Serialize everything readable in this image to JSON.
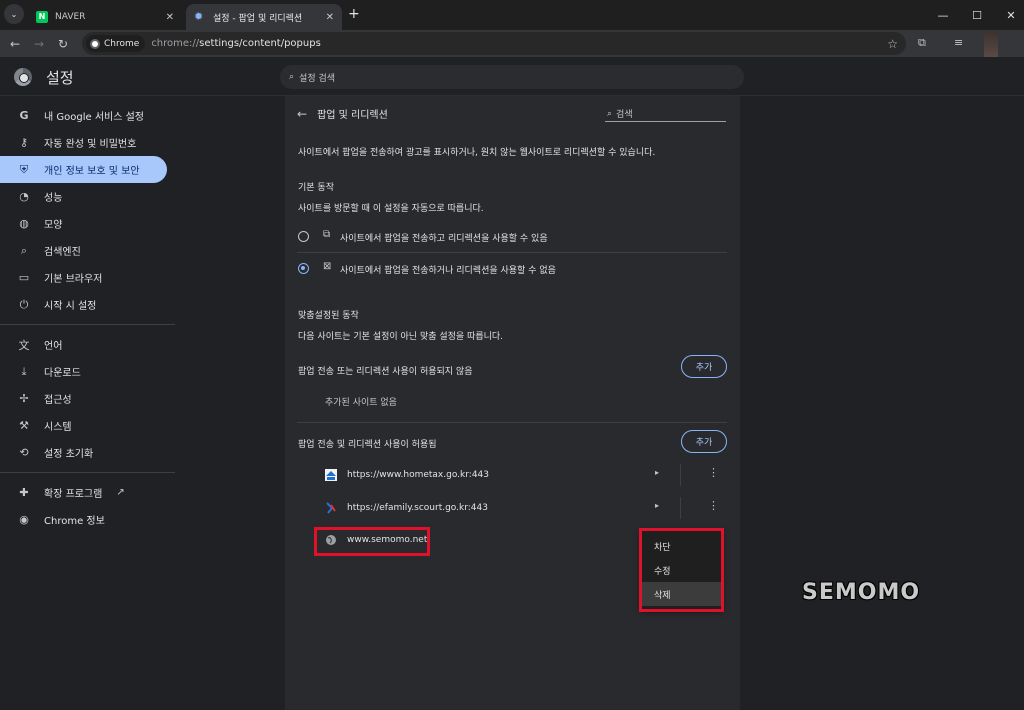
{
  "tabs": [
    {
      "label": "NAVER",
      "favicon": "naver-favicon"
    },
    {
      "label": "설정 - 팝업 및 리디렉션",
      "favicon": "gear-icon"
    }
  ],
  "toolbar": {
    "chip_label": "Chrome",
    "url_scheme": "chrome://",
    "url_path": "settings/content/popups"
  },
  "header": {
    "title": "설정",
    "search_placeholder": "설정 검색"
  },
  "sidebar": {
    "items": [
      {
        "label": "내 Google 서비스 설정",
        "icon": "google-icon"
      },
      {
        "label": "자동 완성 및 비밀번호",
        "icon": "key-icon"
      },
      {
        "label": "개인 정보 보호 및 보안",
        "icon": "shield-icon",
        "active": true
      },
      {
        "label": "성능",
        "icon": "speedometer-icon"
      },
      {
        "label": "모양",
        "icon": "palette-icon"
      },
      {
        "label": "검색엔진",
        "icon": "search-icon"
      },
      {
        "label": "기본 브라우저",
        "icon": "browser-icon"
      },
      {
        "label": "시작 시 설정",
        "icon": "power-icon"
      }
    ],
    "items2": [
      {
        "label": "언어",
        "icon": "translate-icon"
      },
      {
        "label": "다운로드",
        "icon": "download-icon"
      },
      {
        "label": "접근성",
        "icon": "accessibility-icon"
      },
      {
        "label": "시스템",
        "icon": "wrench-icon"
      },
      {
        "label": "설정 초기화",
        "icon": "reset-icon"
      }
    ],
    "items3": [
      {
        "label": "확장 프로그램",
        "icon": "puzzle-icon"
      },
      {
        "label": "Chrome 정보",
        "icon": "chrome-icon"
      }
    ]
  },
  "main": {
    "title": "팝업 및 리디렉션",
    "search_placeholder": "검색",
    "description": "사이트에서 팝업을 전송하여 광고를 표시하거나, 원치 않는 웹사이트로 리디렉션할 수 있습니다.",
    "default_heading": "기본 동작",
    "default_sub": "사이트를 방문할 때 이 설정을 자동으로 따릅니다.",
    "option_allow": "사이트에서 팝업을 전송하고 리디렉션을 사용할 수 있음",
    "option_block": "사이트에서 팝업을 전송하거나 리디렉션을 사용할 수 없음",
    "selected_option": "block",
    "custom_heading": "맞춤설정된 동작",
    "custom_sub": "다음 사이트는 기본 설정이 아닌 맞춤 설정을 따릅니다.",
    "blocked_heading": "팝업 전송 또는 리디렉션 사용이 허용되지 않음",
    "blocked_empty": "추가된 사이트 없음",
    "allowed_heading": "팝업 전송 및 리디렉션 사용이 허용됨",
    "add_label": "추가",
    "allowed_sites": [
      {
        "url": "https://www.hometax.go.kr:443"
      },
      {
        "url": "https://efamily.scourt.go.kr:443"
      },
      {
        "url": "www.semomo.net"
      }
    ]
  },
  "context_menu": {
    "items": [
      "차단",
      "수정",
      "삭제"
    ],
    "hovered": "삭제"
  },
  "watermark": "SEMOMO"
}
